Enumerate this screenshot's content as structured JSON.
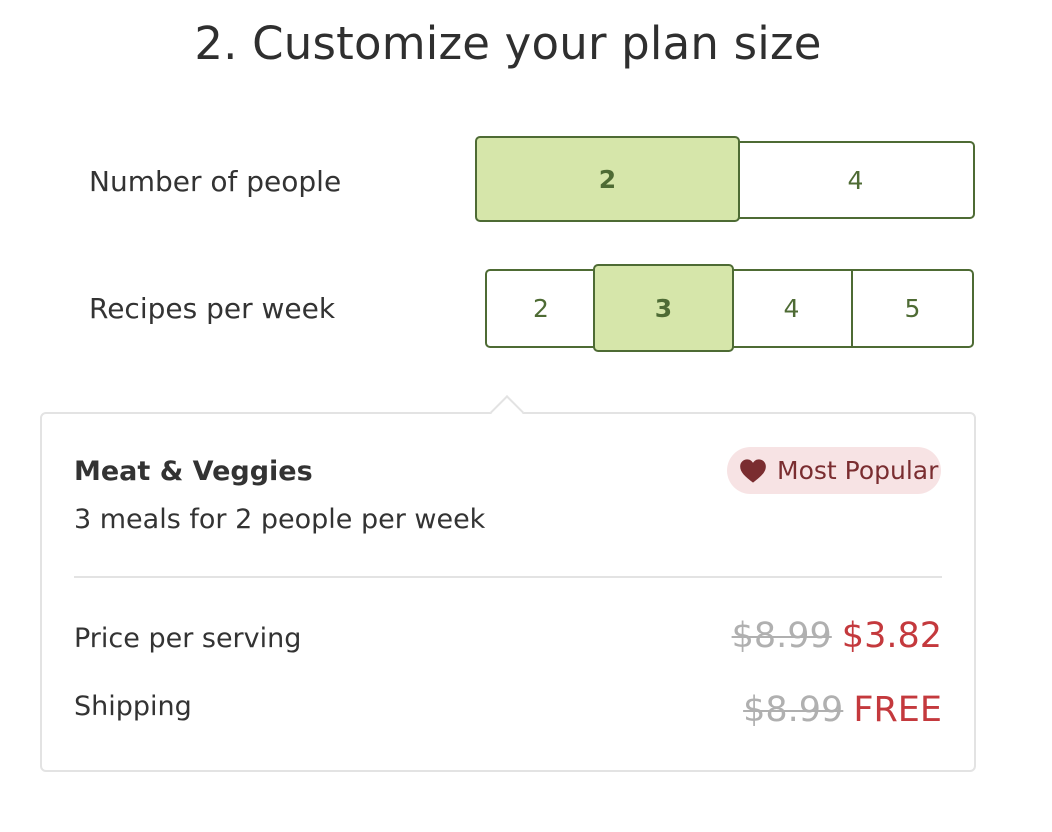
{
  "title": "2. Customize your plan size",
  "people": {
    "label": "Number of people",
    "options": [
      "2",
      "4"
    ],
    "selected": "2"
  },
  "recipes": {
    "label": "Recipes per week",
    "options": [
      "2",
      "3",
      "4",
      "5"
    ],
    "selected": "3"
  },
  "summary": {
    "plan_name": "Meat & Veggies",
    "description": "3 meals for 2 people per week",
    "badge": "Most Popular",
    "badge_icon": "heart-icon",
    "price_label": "Price per serving",
    "price_original": "$8.99",
    "price_current": "$3.82",
    "shipping_label": "Shipping",
    "shipping_original": "$8.99",
    "shipping_current": "FREE"
  },
  "colors": {
    "accent_green": "#4e6b34",
    "selected_fill": "#d6e6aa",
    "sale_red": "#c4393d",
    "badge_bg": "#f7e3e4",
    "badge_text": "#7a2d30"
  }
}
